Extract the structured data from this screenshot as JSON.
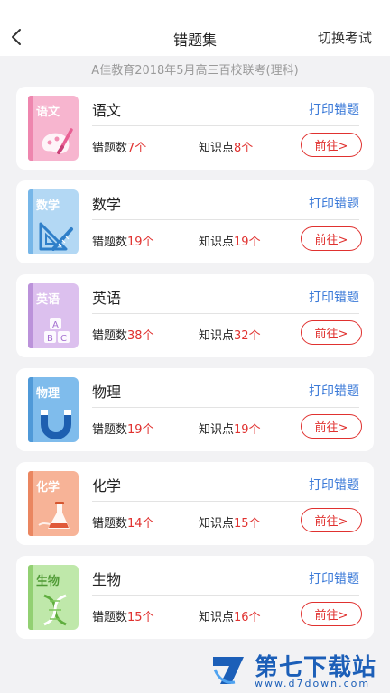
{
  "nav": {
    "title": "错题集",
    "right_action": "切换考试"
  },
  "exam": {
    "title": "A佳教育2018年5月高三百校联考(理科)"
  },
  "labels": {
    "print": "打印错题",
    "errors_prefix": "错题数",
    "knowledge_prefix": "知识点",
    "unit": "个",
    "go": "前往>"
  },
  "subjects": [
    {
      "name": "语文",
      "book_label": "语文",
      "book_color": "#f5a9c6",
      "spine_color": "#ec7aa6",
      "label_color": "#ffffff",
      "errors": "7",
      "knowledge_points": "8"
    },
    {
      "name": "数学",
      "book_label": "数学",
      "book_color": "#a9d2f2",
      "spine_color": "#6fb2e6",
      "label_color": "#ffffff",
      "errors": "19",
      "knowledge_points": "19"
    },
    {
      "name": "英语",
      "book_label": "英语",
      "book_color": "#d7b5ea",
      "spine_color": "#b58ad6",
      "label_color": "#ffffff",
      "errors": "38",
      "knowledge_points": "32"
    },
    {
      "name": "物理",
      "book_label": "物理",
      "book_color": "#79b9ec",
      "spine_color": "#4d98d8",
      "label_color": "#ffffff",
      "errors": "19",
      "knowledge_points": "19"
    },
    {
      "name": "化学",
      "book_label": "化学",
      "book_color": "#f5a98a",
      "spine_color": "#e9805a",
      "label_color": "#ffffff",
      "errors": "14",
      "knowledge_points": "15"
    },
    {
      "name": "生物",
      "book_label": "生物",
      "book_color": "#b9e6a2",
      "spine_color": "#8fcf6f",
      "label_color": "#ffffff",
      "errors": "15",
      "knowledge_points": "16"
    }
  ],
  "icons": {
    "back": "back-chevron-icon",
    "chinese": "brush-palette-icon",
    "math": "ruler-triangle-icon",
    "english": "abc-blocks-icon",
    "physics": "magnet-icon",
    "chemistry": "flask-icon",
    "biology": "dna-icon"
  },
  "watermark": {
    "title": "第七下载站",
    "url": "www.d7down.com"
  },
  "colors": {
    "accent_red": "#e0312f",
    "link_blue": "#3b7ad8",
    "watermark_blue": "#1c5fb8"
  }
}
